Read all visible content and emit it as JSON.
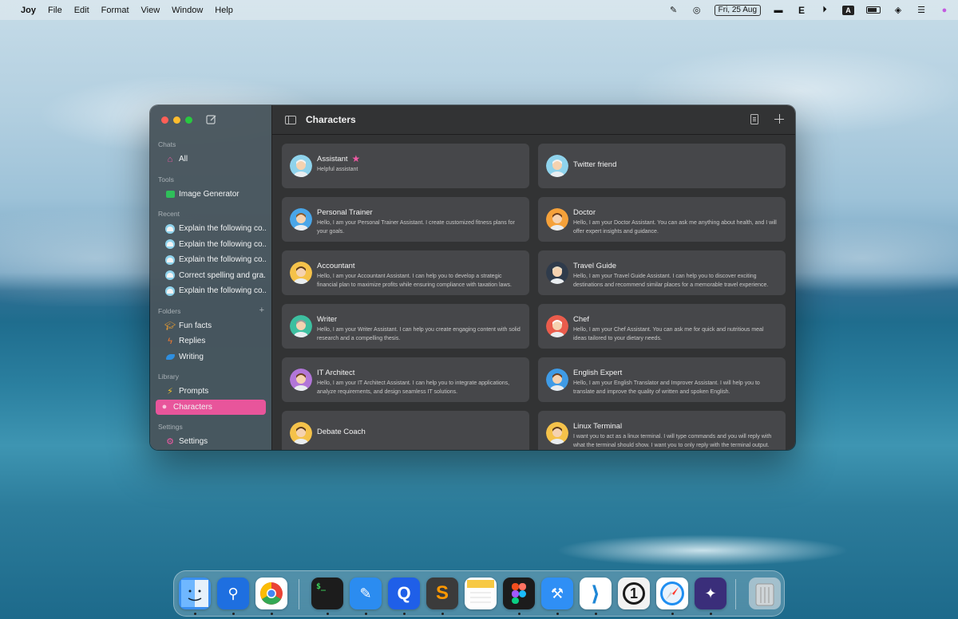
{
  "menubar": {
    "app_name": "Joy",
    "menus": [
      "File",
      "Edit",
      "Format",
      "View",
      "Window",
      "Help"
    ],
    "date": "Fri, 25 Aug",
    "e_label": "E",
    "a_label": "A"
  },
  "window": {
    "title": "Characters",
    "sidebar": {
      "chats_label": "Chats",
      "all_label": "All",
      "tools_label": "Tools",
      "image_generator": "Image Generator",
      "recent_label": "Recent",
      "recent": [
        "Explain the following co...",
        "Explain the following co...",
        "Explain the following co...",
        "Correct spelling and gra...",
        "Explain the following co..."
      ],
      "folders_label": "Folders",
      "folders": [
        "Fun facts",
        "Replies",
        "Writing"
      ],
      "library_label": "Library",
      "prompts": "Prompts",
      "characters": "Characters",
      "settings_label": "Settings",
      "settings": "Settings"
    },
    "cards": [
      {
        "name": "Assistant",
        "desc": "Helpful assistant",
        "favorite": true,
        "skin": "#8fd3ec",
        "hair": "#f3f3f3"
      },
      {
        "name": "Twitter friend",
        "desc": "",
        "favorite": false,
        "skin": "#8fd3ec",
        "hair": "#f3f3f3"
      },
      {
        "name": "Personal Trainer",
        "desc": "Hello, I am your Personal Trainer Assistant. I create customized fitness plans for your goals.",
        "favorite": false,
        "skin": "#4aa6e8",
        "hair": "#8a5a2b"
      },
      {
        "name": "Doctor",
        "desc": "Hello, I am your Doctor Assistant. You can ask me anything about health, and I will offer expert insights and guidance.",
        "favorite": false,
        "skin": "#f5a13a",
        "hair": "#6b3d1e"
      },
      {
        "name": "Accountant",
        "desc": "Hello, I am your Accountant Assistant. I can help you to develop a strategic financial plan to maximize profits while ensuring compliance with taxation laws.",
        "favorite": false,
        "skin": "#f5c24a",
        "hair": "#5a3a1c"
      },
      {
        "name": "Travel Guide",
        "desc": "Hello, I am your Travel Guide Assistant. I can help you to discover exciting destinations and recommend similar places for a memorable travel experience.",
        "favorite": false,
        "skin": "#2f3b4b",
        "hair": "#e9dcc2"
      },
      {
        "name": "Writer",
        "desc": "Hello, I am your Writer Assistant. I can help you create engaging content with solid research and a compelling thesis.",
        "favorite": false,
        "skin": "#3dbfa0",
        "hair": "#9a9a9a"
      },
      {
        "name": "Chef",
        "desc": "Hello, I am your Chef Assistant. You can ask me for quick and nutritious meal ideas tailored to your dietary needs.",
        "favorite": false,
        "skin": "#ea5c4c",
        "hair": "#ffffff"
      },
      {
        "name": "IT Architect",
        "desc": "Hello, I am your IT Architect Assistant. I can help you to integrate applications, analyze requirements, and design seamless IT solutions.",
        "favorite": false,
        "skin": "#b276d8",
        "hair": "#6b3d1e"
      },
      {
        "name": "English Expert",
        "desc": "Hello, I am your English Translator and Improver Assistant. I will help you to translate and improve the quality of written and spoken English.",
        "favorite": false,
        "skin": "#3f9be6",
        "hair": "#6b3d1e"
      },
      {
        "name": "Debate Coach",
        "desc": "",
        "favorite": false,
        "skin": "#f5c24a",
        "hair": "#5a3a1c"
      },
      {
        "name": "Linux Terminal",
        "desc": "I want you to act as a linux terminal. I will type commands and you will reply with what the terminal should show. I want you to only reply with the terminal output.",
        "favorite": false,
        "skin": "#f5c24a",
        "hair": "#5a3a1c"
      }
    ]
  },
  "dock": {
    "apps": [
      {
        "name": "finder",
        "color": "#3a8ff0",
        "glyph": ""
      },
      {
        "name": "maps-pin-app",
        "color": "#1e6fe0",
        "glyph": "⚲"
      },
      {
        "name": "chrome",
        "color": "#ffffff",
        "glyph": ""
      },
      {
        "name": "terminal",
        "color": "#1c1c1c",
        "glyph": "$_"
      },
      {
        "name": "xcode-builder",
        "color": "#2b8cf0",
        "glyph": "✎"
      },
      {
        "name": "proxyman",
        "color": "#1f5fe8",
        "glyph": "Q"
      },
      {
        "name": "sublime-text",
        "color": "#3b3b3b",
        "glyph": "S"
      },
      {
        "name": "notes",
        "color": "#fdfdfd",
        "glyph": ""
      },
      {
        "name": "figma",
        "color": "#1c1c1c",
        "glyph": ""
      },
      {
        "name": "xcode",
        "color": "#2f8ff5",
        "glyph": "⚒"
      },
      {
        "name": "vscode",
        "color": "#ffffff",
        "glyph": "⟩"
      },
      {
        "name": "1password",
        "color": "#f2f2f2",
        "glyph": "1"
      },
      {
        "name": "safari",
        "color": "#ffffff",
        "glyph": ""
      },
      {
        "name": "pixelmator",
        "color": "#3a2e7a",
        "glyph": "✦"
      },
      {
        "name": "trash",
        "color": "rgba(220,225,228,0.6)",
        "glyph": ""
      }
    ]
  }
}
